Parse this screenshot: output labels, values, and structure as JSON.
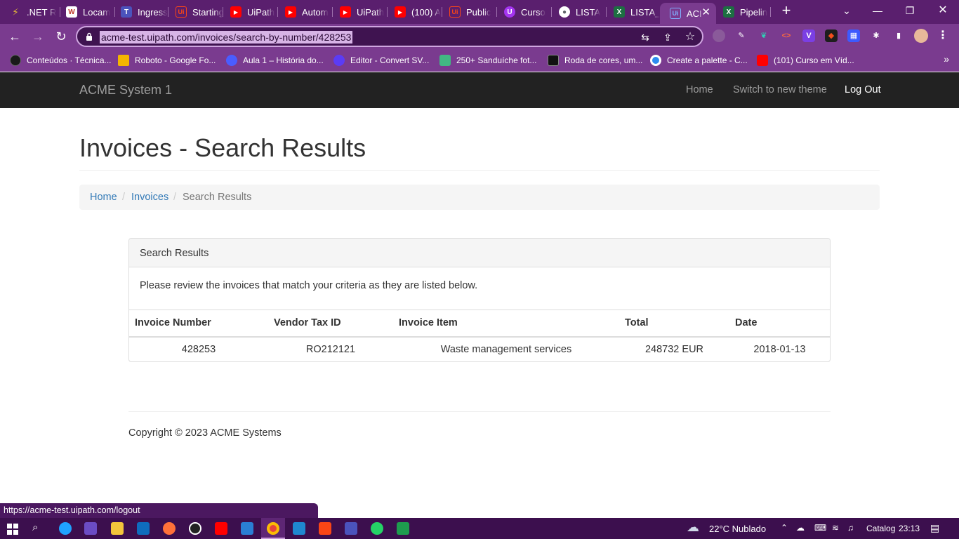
{
  "browser": {
    "tabs": [
      {
        "label": ".NET R",
        "icon": "lightning-icon",
        "color": "#e0b33b",
        "glyph": "⚡"
      },
      {
        "label": "Locam",
        "icon": "w-icon",
        "color": "#c0392b",
        "glyph": "W"
      },
      {
        "label": "Ingress",
        "icon": "teams-icon",
        "color": "#4b53bc",
        "glyph": "T"
      },
      {
        "label": "Starting",
        "icon": "uipath-icon",
        "color": "#fa4616",
        "glyph": "Ui"
      },
      {
        "label": "UiPath",
        "icon": "youtube-icon",
        "color": "#ff0000",
        "glyph": "▶"
      },
      {
        "label": "Autom",
        "icon": "youtube-icon",
        "color": "#ff0000",
        "glyph": "▶"
      },
      {
        "label": "UiPath",
        "icon": "youtube-icon",
        "color": "#ff0000",
        "glyph": "▶"
      },
      {
        "label": "(100) A",
        "icon": "youtube-icon",
        "color": "#ff0000",
        "glyph": "▶"
      },
      {
        "label": "Public",
        "icon": "uipath-icon",
        "color": "#fa4616",
        "glyph": "Ui"
      },
      {
        "label": "Curso",
        "icon": "udemy-icon",
        "color": "#a435f0",
        "glyph": "U"
      },
      {
        "label": "LISTA",
        "icon": "globe-icon",
        "color": "#5f6368",
        "glyph": "●"
      },
      {
        "label": "LISTA_",
        "icon": "excel-icon",
        "color": "#1d6f42",
        "glyph": "X"
      },
      {
        "label": "ACI",
        "icon": "uipath-icon",
        "color": "#3b6ab5",
        "glyph": "Ui"
      },
      {
        "label": "Pipelin",
        "icon": "excel-icon",
        "color": "#1d6f42",
        "glyph": "X"
      }
    ],
    "new_tab": "+",
    "url": "acme-test.uipath.com/invoices/search-by-number/428253",
    "bookmarks": [
      {
        "label": "Conteúdos · Técnica...",
        "color": "#1a1a1a"
      },
      {
        "label": "Roboto - Google Fo...",
        "color": "#f4b400"
      },
      {
        "label": "Aula 1 – História do...",
        "color": "#4a5dff"
      },
      {
        "label": "Editor - Convert SV...",
        "color": "#5b3cf5"
      },
      {
        "label": "250+ Sanduíche fot...",
        "color": "#42b883"
      },
      {
        "label": "Roda de cores, um...",
        "color": "#111111"
      },
      {
        "label": "Create a palette - C...",
        "color": "#2d8cf0"
      },
      {
        "label": "(101) Curso em Víd...",
        "color": "#ff0000"
      }
    ],
    "bookmarks_more": "»",
    "status_url": "https://acme-test.uipath.com/logout"
  },
  "app": {
    "brand": "ACME System 1",
    "nav": {
      "home": "Home",
      "theme": "Switch to new theme",
      "logout": "Log Out"
    },
    "page_title": "Invoices - Search Results",
    "breadcrumb": {
      "home": "Home",
      "invoices": "Invoices",
      "current": "Search Results",
      "sep": "/"
    },
    "panel": {
      "title": "Search Results",
      "text": "Please review the invoices that match your criteria as they are listed below."
    },
    "table": {
      "headers": [
        "Invoice Number",
        "Vendor Tax ID",
        "Invoice Item",
        "Total",
        "Date"
      ],
      "rows": [
        [
          "428253",
          "RO212121",
          "Waste management services",
          "248732 EUR",
          "2018-01-13"
        ]
      ]
    },
    "copyright": "Copyright © 2023 ACME Systems"
  },
  "taskbar": {
    "weather": "22°C  Nublado",
    "app_label": "Catalog",
    "time": "23:13"
  }
}
